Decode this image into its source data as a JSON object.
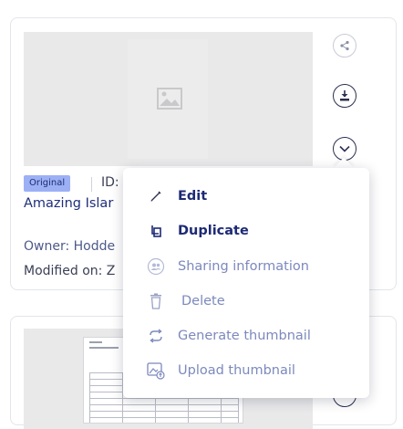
{
  "card1": {
    "badge": "Original",
    "id_label": "ID:",
    "title": "Amazing Islar",
    "owner": "Owner: Hodde",
    "modified": "Modified on: Z"
  },
  "menu": {
    "items": [
      {
        "label": "Edit",
        "icon": "pencil-icon",
        "state": "enabled"
      },
      {
        "label": "Duplicate",
        "icon": "copy-icon",
        "state": "enabled"
      },
      {
        "label": "Sharing information",
        "icon": "people-icon",
        "state": "muted"
      },
      {
        "label": "Delete",
        "icon": "trash-icon",
        "state": "muted"
      },
      {
        "label": "Generate thumbnail",
        "icon": "refresh-icon",
        "state": "muted"
      },
      {
        "label": "Upload thumbnail",
        "icon": "image-upload-icon",
        "state": "muted"
      }
    ]
  },
  "colors": {
    "accent_dark": "#1d2a74",
    "muted_text": "#7c89bd",
    "badge_bg": "#9cb0f5"
  }
}
